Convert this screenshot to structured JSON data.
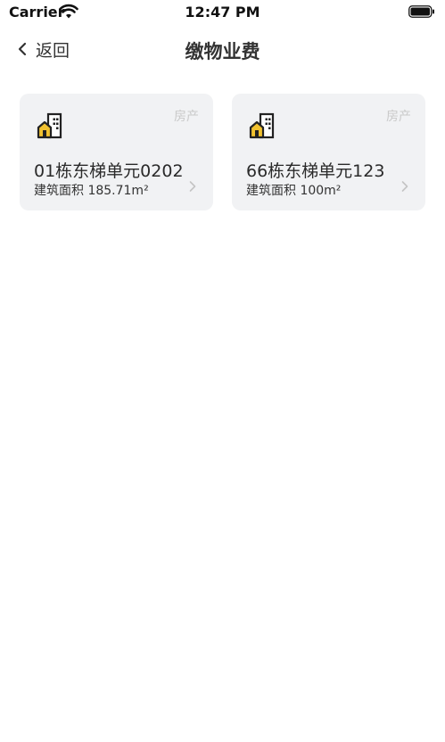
{
  "status_bar": {
    "carrier": "Carrier",
    "time": "12:47 PM"
  },
  "nav": {
    "back_label": "返回",
    "title": "缴物业费"
  },
  "properties": [
    {
      "tag": "房产",
      "name": "01栋东梯单元0202",
      "area": "建筑面积 185.71m²",
      "icon": "building-icon"
    },
    {
      "tag": "房产",
      "name": "66栋东梯单元123",
      "area": "建筑面积 100m²",
      "icon": "building-icon"
    }
  ],
  "colors": {
    "card_bg": "#f1f2f4",
    "icon_yellow": "#f2c230",
    "icon_dark": "#222222",
    "tag_gray": "#c9c9c9"
  }
}
